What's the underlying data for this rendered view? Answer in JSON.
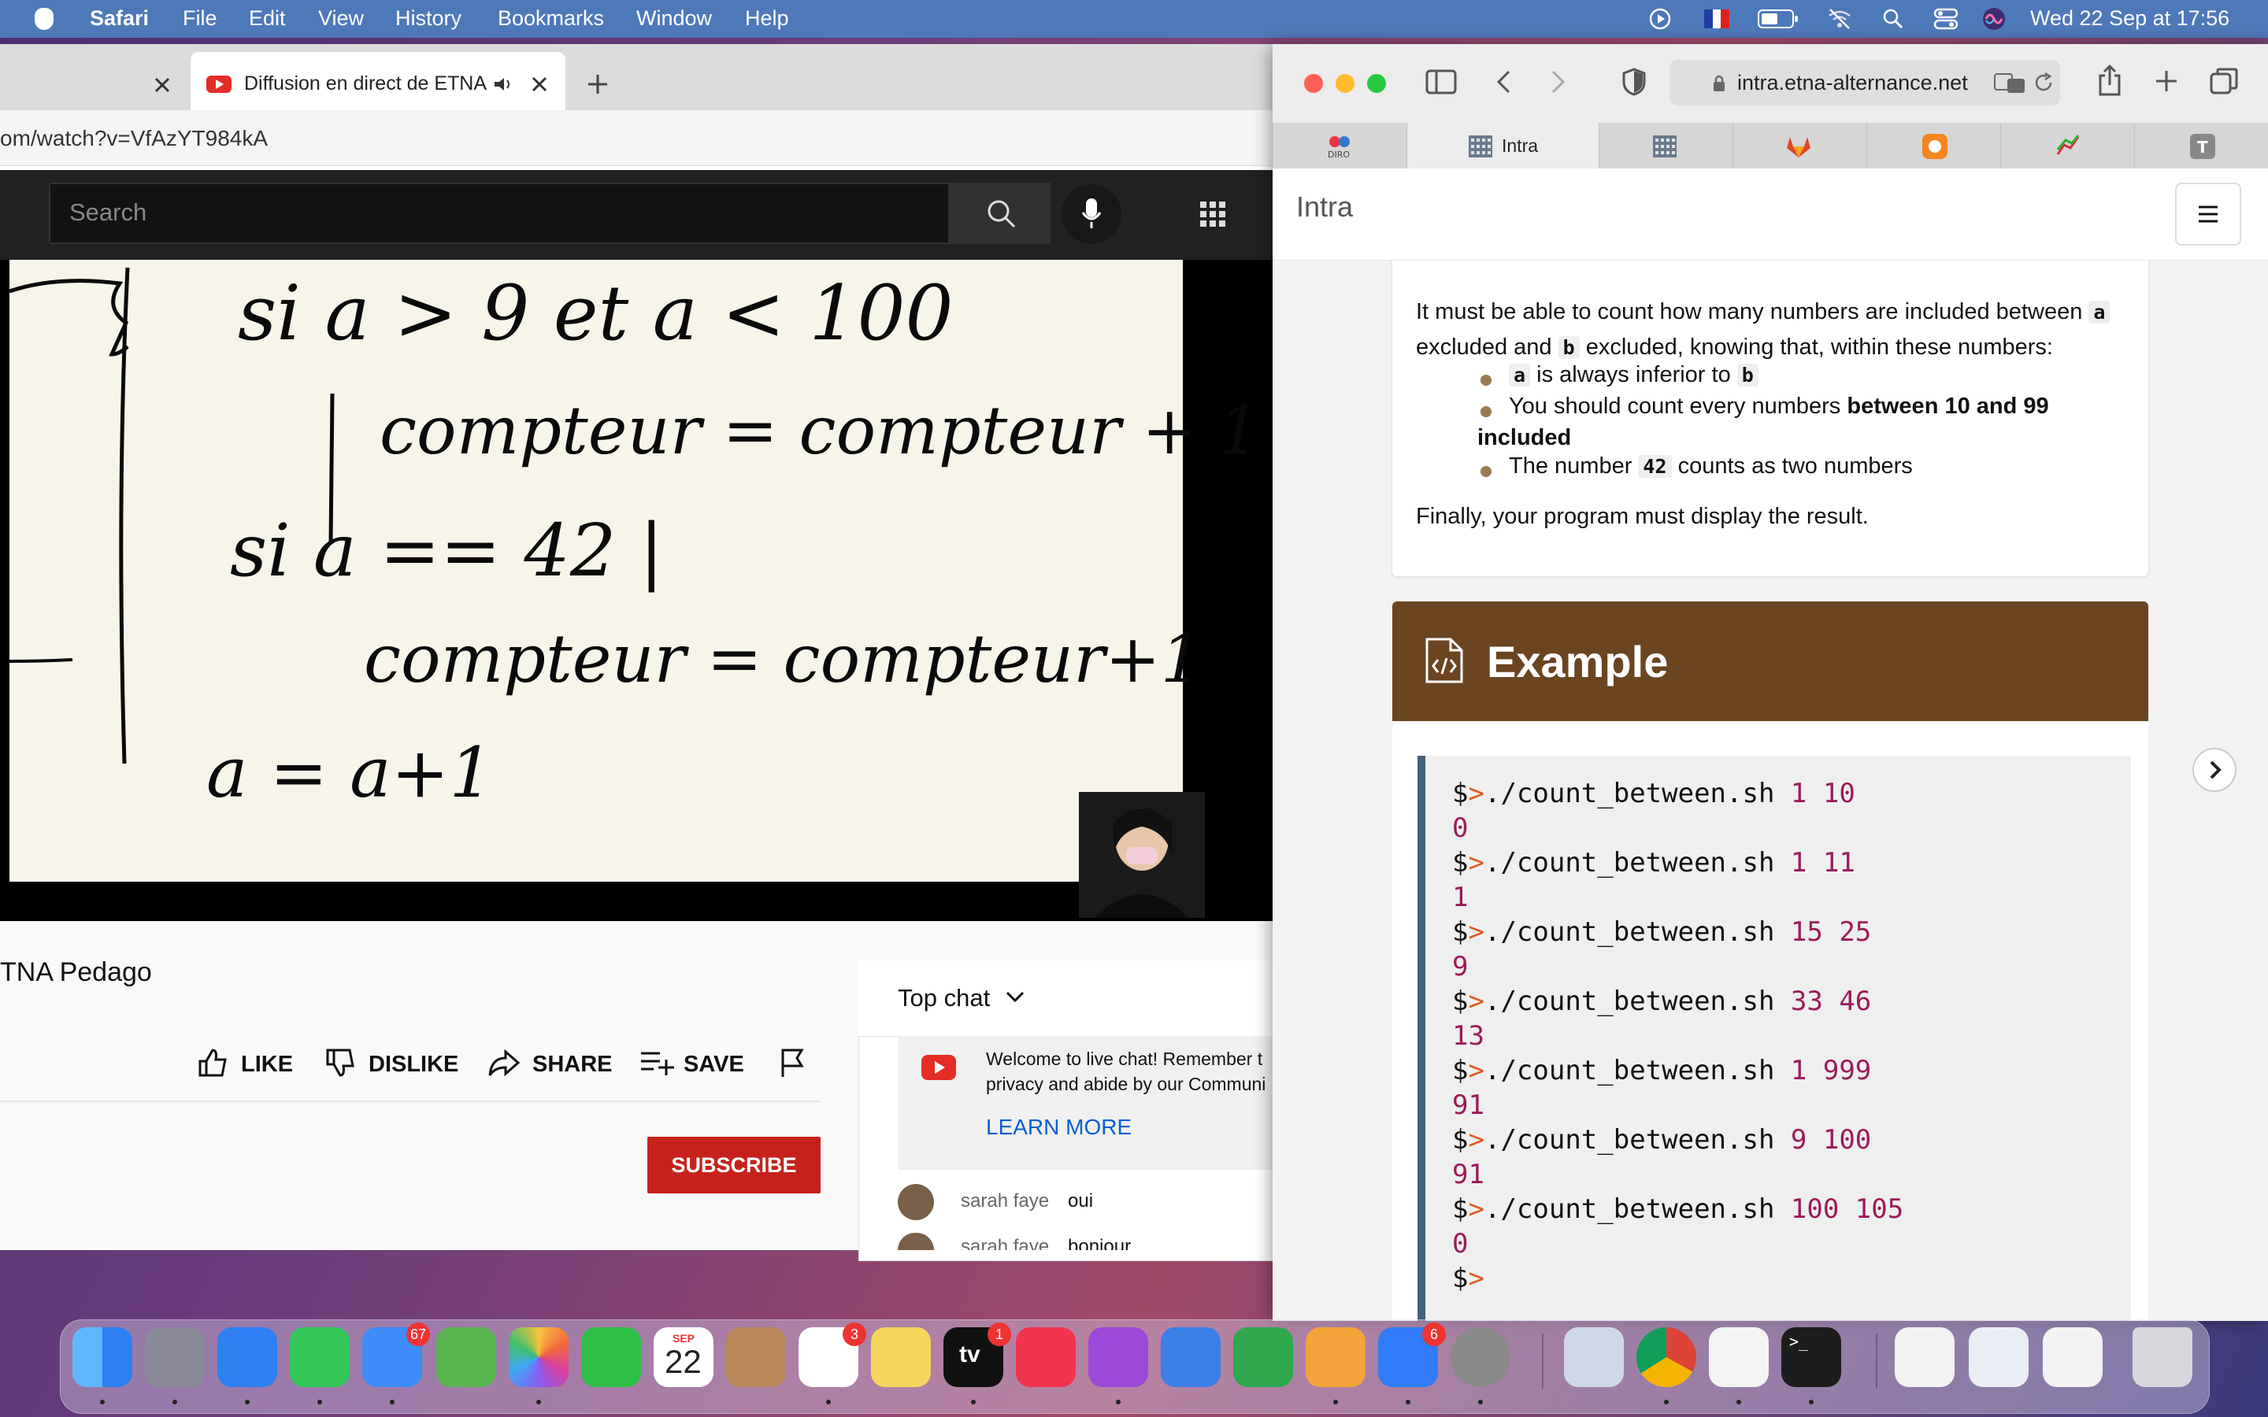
{
  "menubar": {
    "app": "Safari",
    "items": [
      "File",
      "Edit",
      "View",
      "History",
      "Bookmarks",
      "Window",
      "Help"
    ],
    "datetime": "Wed 22 Sep at  17:56",
    "status_icons": [
      "play-circle-icon",
      "flag-fr-icon",
      "battery-icon",
      "wifi-off-icon",
      "search-icon",
      "control-center-icon",
      "siri-icon"
    ]
  },
  "left_window": {
    "tab_title": "Diffusion en direct de ETNA",
    "url_partial": "om/watch?v=VfAzYT984kA",
    "yt": {
      "search_placeholder": "Search",
      "channel_partial": "TNA Pedago",
      "actions": [
        "LIKE",
        "DISLIKE",
        "SHARE",
        "SAVE"
      ],
      "subscribe": "SUBSCRIBE",
      "chat": {
        "header": "Top chat",
        "welcome_line1": "Welcome to live chat! Remember t",
        "welcome_line2": "privacy and abide by our Communi",
        "learn_more": "LEARN MORE",
        "messages": [
          {
            "author": "sarah faye",
            "text": "oui"
          },
          {
            "author": "sarah faye",
            "text": "bonjour"
          }
        ]
      }
    },
    "whiteboard": {
      "lines": [
        "si  a > 9  et  a < 100",
        "compteur = compteur + 1",
        "si   a  ==  42  |",
        "compteur = compteur+1",
        "a = a+1"
      ]
    }
  },
  "right_window": {
    "url": "intra.etna-alternance.net",
    "tabs": [
      {
        "label": "",
        "icon": "diro-icon"
      },
      {
        "label": "Intra",
        "icon": "etna-icon"
      },
      {
        "label": "",
        "icon": "etna-icon-2"
      },
      {
        "label": "",
        "icon": "gitlab-icon"
      },
      {
        "label": "",
        "icon": "orange-app-icon"
      },
      {
        "label": "",
        "icon": "chart-app-icon"
      },
      {
        "label": "",
        "icon": "t-icon"
      }
    ],
    "page_title": "Intra",
    "description": {
      "intro_1": "It must be able to count how many numbers are included between",
      "var_a": "a",
      "intro_2": "excluded and",
      "var_b": "b",
      "intro_3": "excluded, knowing that, within these numbers:",
      "bullet1_var_a": "a",
      "bullet1_text": "is always inferior to",
      "bullet1_var_b": "b",
      "bullet2_text": "You should count every numbers ",
      "bullet2_bold": "between 10 and 99",
      "bullet2_bold_2": "included",
      "bullet3_text_1": "The number",
      "bullet3_code": "42",
      "bullet3_text_2": "counts as two numbers",
      "final": "Finally, your program must display the result."
    },
    "example": {
      "title": "Example",
      "prompt": "$",
      "prompt_arrow": ">",
      "lines": [
        {
          "cmd": "./count_between.sh",
          "args": "1 10",
          "out": "0"
        },
        {
          "cmd": "./count_between.sh",
          "args": "1 11",
          "out": "1"
        },
        {
          "cmd": "./count_between.sh",
          "args": "15 25",
          "out": "9"
        },
        {
          "cmd": "./count_between.sh",
          "args": "33 46",
          "out": "13"
        },
        {
          "cmd": "./count_between.sh",
          "args": "1 999",
          "out": "91"
        },
        {
          "cmd": "./count_between.sh",
          "args": "9 100",
          "out": "91"
        },
        {
          "cmd": "./count_between.sh",
          "args": "100 105",
          "out": "0"
        }
      ]
    }
  },
  "dock": {
    "calendar_month": "SEP",
    "calendar_day": "22",
    "badges": {
      "mail": "67",
      "reminders": "3",
      "appletv": "1",
      "appstore": "6"
    },
    "apps": [
      "finder-icon",
      "launchpad-icon",
      "safari-icon",
      "messages-icon",
      "mail-icon",
      "maps-icon",
      "photos-icon",
      "facetime-icon",
      "calendar-icon",
      "contacts-icon",
      "reminders-icon",
      "notes-icon",
      "appletv-icon",
      "music-icon",
      "podcasts-icon",
      "keynote-icon",
      "numbers-icon",
      "pages-icon",
      "appstore-icon",
      "settings-icon",
      "preview-icon",
      "chrome-icon",
      "textedit-icon",
      "terminal-icon",
      "window-thumb-icon",
      "window-thumb-icon",
      "window-thumb-icon",
      "trash-icon"
    ],
    "appletv_label": "tv"
  },
  "colors": {
    "menubar": "#4e79b8",
    "yt_red": "#c6221b",
    "example_header": "#6b4520",
    "code_number": "#9b1b5a",
    "code_prompt": "#e05a20"
  }
}
